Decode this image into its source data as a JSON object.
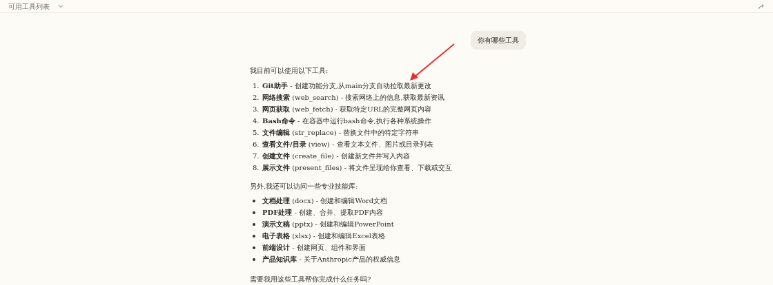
{
  "header": {
    "title": "可用工具列表"
  },
  "user_message": {
    "text": "你有哪些工具"
  },
  "reply": {
    "intro": "我目前可以使用以下工具:",
    "tools": [
      {
        "number": "1.",
        "text": "**Git助手** - 创建功能分支,从main分支自动拉取最新更改"
      },
      {
        "number": "2.",
        "text": "**网络搜索** (web_search) - 搜索网络上的信息,获取最新资讯"
      },
      {
        "number": "3.",
        "text": "**网页获取** (web_fetch) - 获取特定URL的完整网页内容"
      },
      {
        "number": "4.",
        "text": "**Bash命令** - 在容器中运行bash命令,执行各种系统操作"
      },
      {
        "number": "5.",
        "text": "**文件编辑** (str_replace) - 替换文件中的特定字符串"
      },
      {
        "number": "6.",
        "text": "**查看文件/目录** (view) - 查看文本文件、图片或目录列表"
      },
      {
        "number": "7.",
        "text": "**创建文件** (create_file) - 创建新文件并写入内容"
      },
      {
        "number": "8.",
        "text": "**展示文件** (present_files) - 将文件呈现给你查看、下载或交互"
      }
    ],
    "skills_intro": "另外,我还可以访问一些专业技能库:",
    "skills": [
      "**文档处理** (docx) - 创建和编辑Word文档",
      "**PDF处理** - 创建、合并、提取PDF内容",
      "**演示文稿** (pptx) - 创建和编辑PowerPoint",
      "**电子表格** (xlsx) - 创建和编辑Excel表格",
      "**前端设计** - 创建网页、组件和界面",
      "**产品知识库** - 关于Anthropic产品的权威信息"
    ],
    "closing": "需要我用这些工具帮你完成什么任务吗?"
  }
}
